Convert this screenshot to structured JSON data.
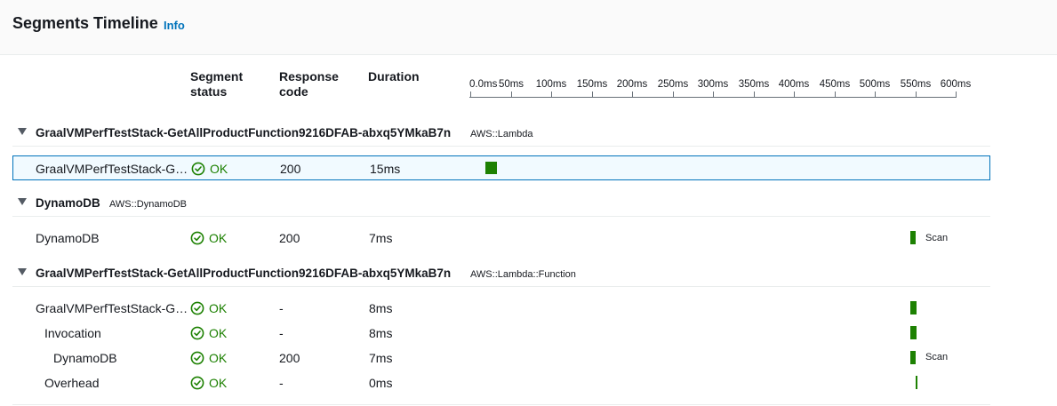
{
  "header": {
    "title": "Segments Timeline",
    "info": "Info"
  },
  "columns": {
    "status_line1": "Segment",
    "status_line2": "status",
    "code_line1": "Response",
    "code_line2": "code",
    "duration": "Duration"
  },
  "axis": {
    "ticks": [
      "0.0ms",
      "50ms",
      "100ms",
      "150ms",
      "200ms",
      "250ms",
      "300ms",
      "350ms",
      "400ms",
      "450ms",
      "500ms",
      "550ms",
      "600ms"
    ]
  },
  "colors": {
    "ok": "#1d8102",
    "link": "#0073bb",
    "selected_border": "#0073bb"
  },
  "groups": [
    {
      "name": "GraalVMPerfTestStack-GetAllProductFunction9216DFAB-abxq5YMkaB7n",
      "type": "AWS::Lambda",
      "rows": [
        {
          "name": "GraalVMPerfTestStack-GetAllProductFunction9216DFAB-abxq5YMkaB7n",
          "status": "OK",
          "code": "200",
          "duration": "15ms",
          "selected": true,
          "bar_label": ""
        }
      ]
    },
    {
      "name": "DynamoDB",
      "type": "AWS::DynamoDB",
      "rows": [
        {
          "name": "DynamoDB",
          "status": "OK",
          "code": "200",
          "duration": "7ms",
          "selected": false,
          "bar_label": "Scan"
        }
      ]
    },
    {
      "name": "GraalVMPerfTestStack-GetAllProductFunction9216DFAB-abxq5YMkaB7n",
      "type": "AWS::Lambda::Function",
      "rows": [
        {
          "name": "GraalVMPerfTestStack-GetAllProductFunction9216DFAB-abxq5YMkaB7n",
          "status": "OK",
          "code": "-",
          "duration": "8ms",
          "selected": false,
          "bar_label": ""
        },
        {
          "name": "Invocation",
          "status": "OK",
          "code": "-",
          "duration": "8ms",
          "selected": false,
          "bar_label": ""
        },
        {
          "name": "DynamoDB",
          "status": "OK",
          "code": "200",
          "duration": "7ms",
          "selected": false,
          "bar_label": "Scan"
        },
        {
          "name": "Overhead",
          "status": "OK",
          "code": "-",
          "duration": "0ms",
          "selected": false,
          "bar_label": ""
        }
      ]
    }
  ]
}
